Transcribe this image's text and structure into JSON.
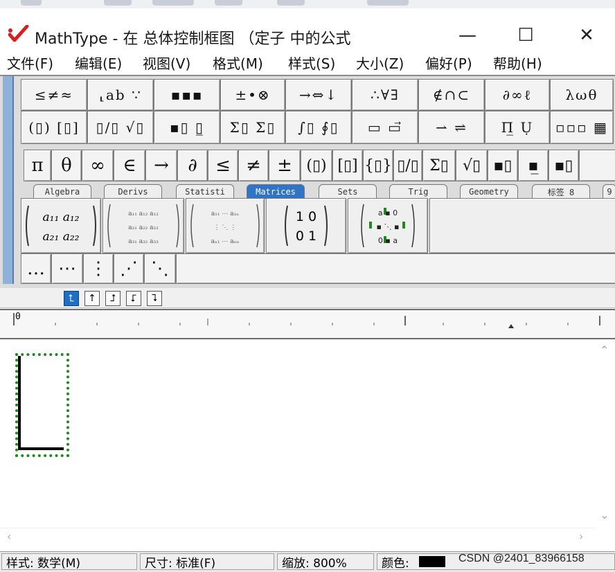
{
  "window": {
    "app_name": "MathType",
    "title": "MathType - 在 总体控制框图 （定子 中的公式",
    "minimize_symbol": "—",
    "maximize_symbol": "☐",
    "close_symbol": "✕"
  },
  "menu": [
    {
      "label": "文件(F)"
    },
    {
      "label": "编辑(E)"
    },
    {
      "label": "视图(V)"
    },
    {
      "label": "格式(M)"
    },
    {
      "label": "样式(S)"
    },
    {
      "label": "大小(Z)"
    },
    {
      "label": "偏好(P)"
    },
    {
      "label": "帮助(H)"
    }
  ],
  "symbol_palettes_row1": [
    {
      "label": "≤≠≈",
      "name": "relational-symbols-palette"
    },
    {
      "label": "⸤ab ∵",
      "name": "spaces-ellipses-palette"
    },
    {
      "label": "▪▪▪",
      "name": "embellishments-palette"
    },
    {
      "label": "±•⊗",
      "name": "operator-symbols-palette"
    },
    {
      "label": "→⇔↓",
      "name": "arrow-symbols-palette"
    },
    {
      "label": "∴∀∃",
      "name": "logical-symbols-palette"
    },
    {
      "label": "∉∩⊂",
      "name": "set-theory-palette"
    },
    {
      "label": "∂∞ℓ",
      "name": "misc-symbols-palette"
    },
    {
      "label": "λωθ",
      "name": "greek-lowercase-palette"
    }
  ],
  "template_palettes_row2": [
    {
      "label": "(▯) [▯]",
      "name": "fence-templates-palette"
    },
    {
      "label": "▯/▯ √▯",
      "name": "fraction-radical-templates-palette"
    },
    {
      "label": "▪▯ ▯̲",
      "name": "subscript-superscript-templates-palette"
    },
    {
      "label": "Σ▯ Σ▯",
      "name": "summation-templates-palette"
    },
    {
      "label": "∫▯ ∮▯",
      "name": "integral-templates-palette"
    },
    {
      "label": "▭ ▭⃗",
      "name": "underbar-overbar-templates-palette"
    },
    {
      "label": "⇀ ⇌",
      "name": "labeled-arrow-templates-palette"
    },
    {
      "label": "Π̲ Ụ",
      "name": "products-set-templates-palette"
    },
    {
      "label": "▫▫▫ ▦",
      "name": "matrix-templates-palette"
    }
  ],
  "small_bar": [
    "π",
    "θ",
    "∞",
    "∈",
    "→",
    "∂",
    "≤",
    "≠",
    "±",
    "(▯)",
    "[▯]",
    "{▯}",
    "▯/▯",
    "Σ▯",
    "√▯",
    "▪▯",
    "▪̲",
    "▪▯"
  ],
  "tabs": [
    {
      "label": "Algebra"
    },
    {
      "label": "Derivs"
    },
    {
      "label": "Statisti"
    },
    {
      "label": "Matrices"
    },
    {
      "label": "Sets"
    },
    {
      "label": "Trig"
    },
    {
      "label": "Geometry"
    },
    {
      "label": "标签 8"
    },
    {
      "label": "9"
    }
  ],
  "matrix_templates": [
    {
      "name": "matrix-2x2-template",
      "r1": "a₁₁  a₁₂",
      "r2": "a₂₁  a₂₂"
    },
    {
      "name": "matrix-3x3-template",
      "r1": "a₁₁ a₁₂ a₁₃",
      "r2": "a₂₁ a₂₂ a₂₃",
      "r3": "a₃₁ a₃₂ a₃₃"
    },
    {
      "name": "matrix-nxn-template",
      "r1": "a₁₁ ⋯ a₁ₙ",
      "r2": "⋮  ⋱  ⋮",
      "r3": "aₙ₁ ⋯ aₙₙ"
    },
    {
      "name": "identity-matrix-template",
      "r1": "1  0",
      "r2": "0  1"
    },
    {
      "name": "diagonal-matrix-template",
      "r1": "a  ▪  0",
      "r2": "▪  ⋱  ▪",
      "r3": "0  ▪  a"
    }
  ],
  "dot_buttons": [
    "…",
    "⋯",
    "⋮",
    "⋰",
    "⋱"
  ],
  "nudge_arrows": [
    "⮤",
    "↑",
    "⮥",
    "⮦",
    "⮧"
  ],
  "ruler": {
    "zero_label": "0"
  },
  "status": {
    "style": "样式: 数学(M)",
    "size": "尺寸: 标准(F)",
    "zoom": "缩放: 800%",
    "color_label": "颜色:",
    "color_value": "#000000"
  },
  "watermark": "CSDN @2401_83966158"
}
